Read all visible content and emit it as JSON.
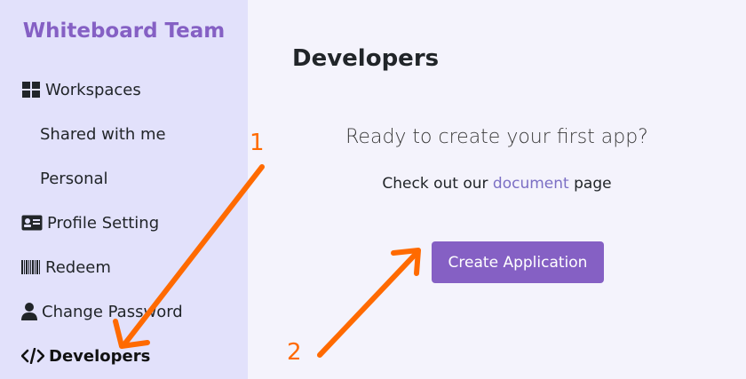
{
  "sidebar": {
    "brand": "Whiteboard Team",
    "items": [
      {
        "label": "Workspaces",
        "icon": "grid-icon"
      },
      {
        "label": "Shared with me"
      },
      {
        "label": "Personal"
      },
      {
        "label": "Profile Setting",
        "icon": "id-card-icon"
      },
      {
        "label": "Redeem",
        "icon": "barcode-icon"
      },
      {
        "label": "Change Password",
        "icon": "user-icon"
      },
      {
        "label": "Developers",
        "icon": "code-icon",
        "active": true
      }
    ]
  },
  "main": {
    "title": "Developers",
    "lead": "Ready to create your first app?",
    "doc_prefix": "Check out our",
    "doc_link": "document",
    "doc_suffix": "page",
    "create_button": "Create Application"
  },
  "annotations": {
    "step1": "1",
    "step2": "2",
    "arrow_color": "#ff6a00"
  },
  "colors": {
    "accent": "#8560c4",
    "sidebar_bg": "#e2e1fb",
    "main_bg": "#f4f3fc",
    "link": "#7b6fc4"
  }
}
